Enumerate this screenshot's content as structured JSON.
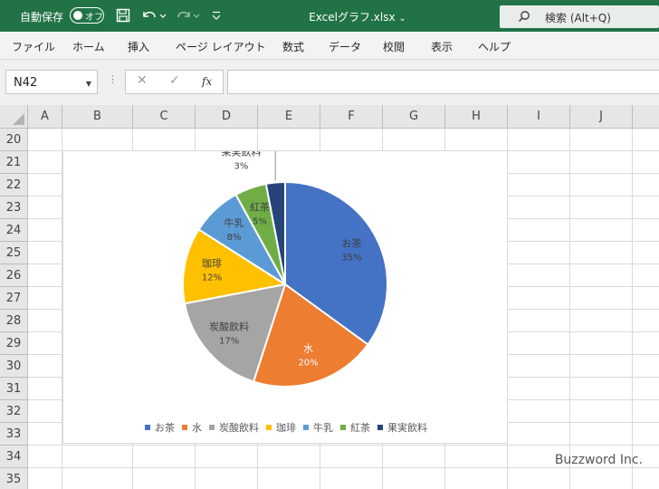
{
  "titlebar": {
    "autosave_label": "自動保存",
    "autosave_state": "オフ",
    "filename": "Excelグラフ.xlsx",
    "filename_chevron": "⌄",
    "search_label": "検索 (Alt+Q)",
    "bg_color": "#217346"
  },
  "ribbon": {
    "tabs": [
      "ファイル",
      "ホーム",
      "挿入",
      "ページ レイアウト",
      "数式",
      "データ",
      "校閲",
      "表示",
      "ヘルプ"
    ]
  },
  "formula_bar": {
    "name_box": "N42",
    "name_box_arrow": "▼",
    "separator": "⋮",
    "cancel": "✕",
    "confirm": "✓",
    "fx": "fx",
    "formula": ""
  },
  "sheet": {
    "columns": [
      "A",
      "B",
      "C",
      "D",
      "E",
      "F",
      "G",
      "H",
      "I",
      "J"
    ],
    "rows": [
      "20",
      "21",
      "22",
      "23",
      "24",
      "25",
      "26",
      "27",
      "28",
      "29",
      "30",
      "31",
      "32",
      "33",
      "34",
      "35"
    ]
  },
  "chart_data": {
    "type": "pie",
    "categories": [
      "お茶",
      "水",
      "炭酸飲料",
      "珈琲",
      "牛乳",
      "紅茶",
      "果実飲料"
    ],
    "values": [
      35,
      20,
      17,
      12,
      8,
      5,
      3
    ],
    "value_labels": [
      "35%",
      "20%",
      "17%",
      "12%",
      "8%",
      "5%",
      "3%"
    ],
    "colors": [
      "#4472c4",
      "#ed7d31",
      "#a5a5a5",
      "#ffc000",
      "#5b9bd5",
      "#70ad47",
      "#264478"
    ],
    "title": "",
    "legend_position": "bottom",
    "legend_marker": "■"
  },
  "watermark": "Buzzword Inc."
}
